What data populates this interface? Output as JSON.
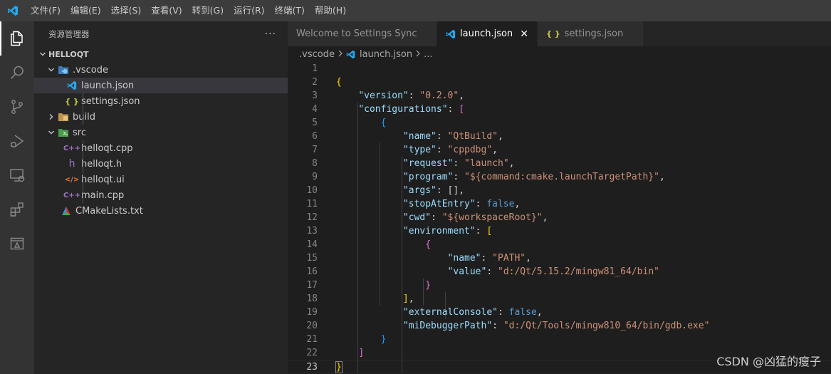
{
  "menu": [
    "文件(F)",
    "编辑(E)",
    "选择(S)",
    "查看(V)",
    "转到(G)",
    "运行(R)",
    "终端(T)",
    "帮助(H)"
  ],
  "sidebar": {
    "title": "资源管理器",
    "more": "···",
    "root": "HELLOQT",
    "items": [
      {
        "label": ".vscode",
        "type": "folder-open"
      },
      {
        "label": "launch.json",
        "type": "vscode"
      },
      {
        "label": "settings.json",
        "type": "json"
      },
      {
        "label": "build",
        "type": "folder-closed"
      },
      {
        "label": "src",
        "type": "folder-open"
      },
      {
        "label": "helloqt.cpp",
        "type": "cpp"
      },
      {
        "label": "helloqt.h",
        "type": "header"
      },
      {
        "label": "helloqt.ui",
        "type": "ui"
      },
      {
        "label": "main.cpp",
        "type": "cpp"
      },
      {
        "label": "CMakeLists.txt",
        "type": "cmake"
      }
    ]
  },
  "tabs": [
    {
      "label": "Welcome to Settings Sync",
      "active": false
    },
    {
      "label": "launch.json",
      "active": true,
      "close": "✕"
    },
    {
      "label": "settings.json",
      "active": false
    }
  ],
  "breadcrumb": {
    "folder": ".vscode",
    "file": "launch.json",
    "tail": "..."
  },
  "code": {
    "line_numbers": [
      "1",
      "2",
      "3",
      "4",
      "5",
      "6",
      "7",
      "8",
      "9",
      "10",
      "11",
      "12",
      "13",
      "14",
      "15",
      "16",
      "17",
      "18",
      "19",
      "20",
      "21",
      "22",
      "23"
    ],
    "current_line": 23,
    "tokens": {
      "l2_open": "{",
      "k_version": "\"version\"",
      "v_version": "\"0.2.0\"",
      "k_configurations": "\"configurations\"",
      "l4_open": "[",
      "l5_open": "{",
      "k_name": "\"name\"",
      "v_name": "\"QtBuild\"",
      "k_type": "\"type\"",
      "v_type": "\"cppdbg\"",
      "k_request": "\"request\"",
      "v_request": "\"launch\"",
      "k_program": "\"program\"",
      "v_program": "\"${command:cmake.launchTargetPath}\"",
      "k_args": "\"args\"",
      "v_args": "[]",
      "k_stop": "\"stopAtEntry\"",
      "v_stop": "false",
      "k_cwd": "\"cwd\"",
      "v_cwd": "\"${workspaceRoot}\"",
      "k_env": "\"environment\"",
      "l13_open": "[",
      "l14_open": "{",
      "k_env_name": "\"name\"",
      "v_env_name": "\"PATH\"",
      "k_env_value": "\"value\"",
      "v_env_value": "\"d:/Qt/5.15.2/mingw81_64/bin\"",
      "l17_close": "}",
      "l18_close": "]",
      "k_console": "\"externalConsole\"",
      "v_console": "false",
      "k_midebug": "\"miDebuggerPath\"",
      "v_midebug": "\"d:/Qt/Tools/mingw810_64/bin/gdb.exe\"",
      "l21_close": "}",
      "l22_close": "]",
      "l23_close": "}"
    }
  },
  "watermark": "CSDN @凶猛的瘦子",
  "colors": {
    "accent": "#007acc",
    "key": "#9cdcfe",
    "string": "#ce9178",
    "keyword": "#569cd6"
  }
}
